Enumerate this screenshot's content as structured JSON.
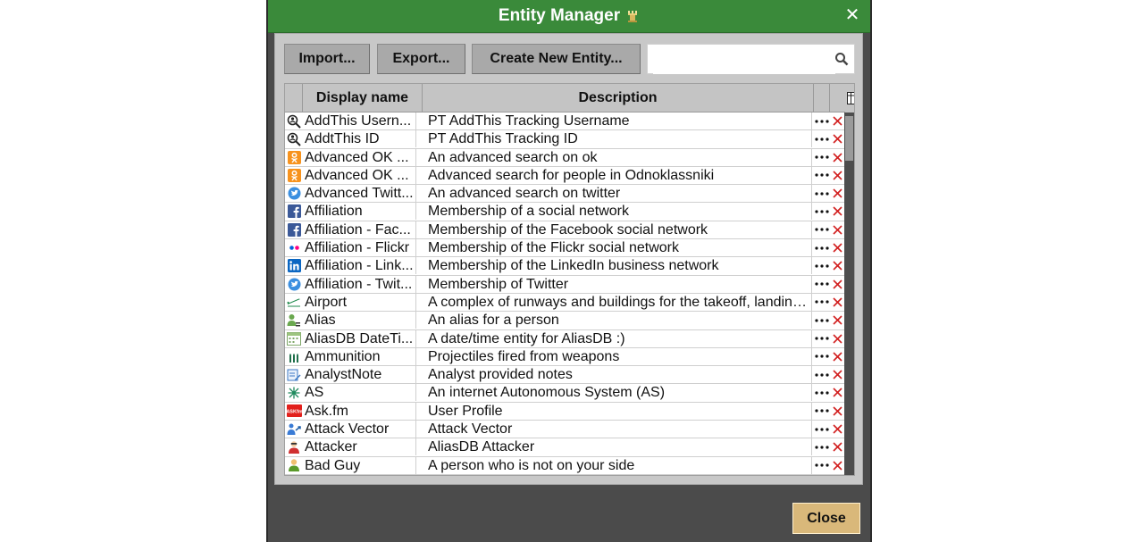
{
  "dialog": {
    "title": "Entity Manager",
    "title_icon": "chess-rook-icon",
    "close_icon": "close-icon",
    "accent": "#3a8a3a"
  },
  "toolbar": {
    "import_label": "Import...",
    "export_label": "Export...",
    "create_label": "Create New Entity...",
    "search_placeholder": "",
    "search_value": ""
  },
  "table": {
    "columns": [
      "Display name",
      "Description"
    ],
    "rows": [
      {
        "icon": "magnifier-user-icon",
        "name": "AddThis Usern...",
        "description": "PT AddThis Tracking Username"
      },
      {
        "icon": "magnifier-user-icon",
        "name": "AddtThis ID",
        "description": "PT AddThis Tracking ID"
      },
      {
        "icon": "odnoklassniki-icon",
        "name": "Advanced OK ...",
        "description": "An advanced search on ok"
      },
      {
        "icon": "odnoklassniki-icon",
        "name": "Advanced OK ...",
        "description": "Advanced search for people in Odnoklassniki"
      },
      {
        "icon": "twitter-icon",
        "name": "Advanced Twitt...",
        "description": "An advanced search on twitter"
      },
      {
        "icon": "facebook-icon",
        "name": "Affiliation",
        "description": "Membership of a social network"
      },
      {
        "icon": "facebook-icon",
        "name": "Affiliation - Fac...",
        "description": "Membership of the Facebook social network"
      },
      {
        "icon": "flickr-icon",
        "name": "Affiliation - Flickr",
        "description": "Membership of the Flickr social network"
      },
      {
        "icon": "linkedin-icon",
        "name": "Affiliation - Link...",
        "description": "Membership of the LinkedIn business network"
      },
      {
        "icon": "twitter-icon",
        "name": "Affiliation - Twit...",
        "description": "Membership of Twitter"
      },
      {
        "icon": "airplane-icon",
        "name": "Airport",
        "description": "A complex of runways and buildings for the takeoff, landing..."
      },
      {
        "icon": "alias-person-icon",
        "name": "Alias",
        "description": "An alias for a person"
      },
      {
        "icon": "calendar-icon",
        "name": "AliasDB DateTi...",
        "description": "A date/time entity for AliasDB :)"
      },
      {
        "icon": "bullets-icon",
        "name": "Ammunition",
        "description": "Projectiles fired from weapons"
      },
      {
        "icon": "note-icon",
        "name": "AnalystNote",
        "description": "Analyst provided notes"
      },
      {
        "icon": "network-node-icon",
        "name": "AS",
        "description": "An internet Autonomous System (AS)"
      },
      {
        "icon": "askfm-icon",
        "name": "Ask.fm",
        "description": "User Profile"
      },
      {
        "icon": "attack-vector-icon",
        "name": "Attack Vector",
        "description": "Attack Vector"
      },
      {
        "icon": "attacker-icon",
        "name": "Attacker",
        "description": "AliasDB Attacker"
      },
      {
        "icon": "bad-guy-icon",
        "name": "Bad Guy",
        "description": "A person who is not on your side"
      }
    ]
  },
  "footer": {
    "close_label": "Close"
  }
}
